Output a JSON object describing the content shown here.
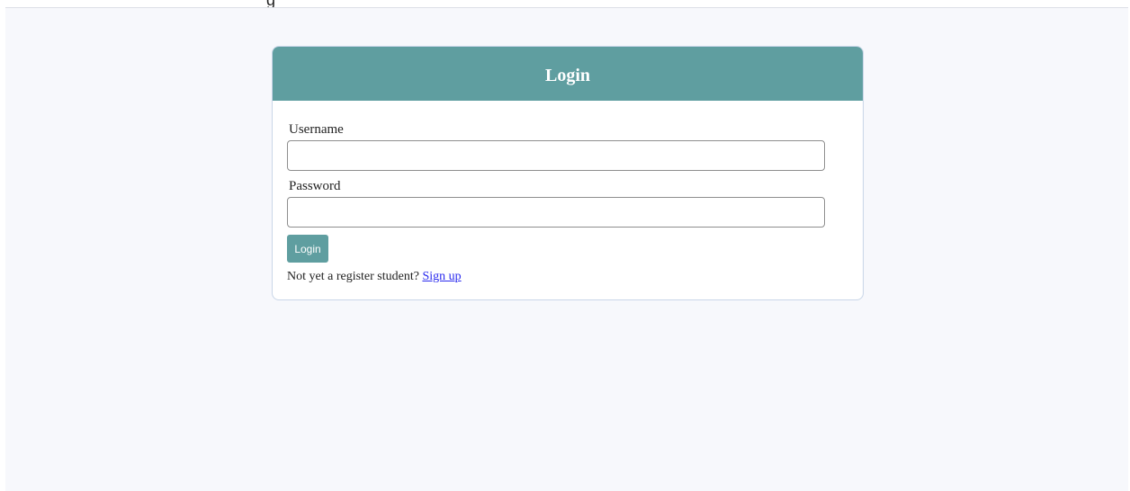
{
  "top_fragment": "g",
  "login_card": {
    "title": "Login",
    "username_label": "Username",
    "username_value": "",
    "password_label": "Password",
    "password_value": "",
    "login_button_label": "Login",
    "signup_prompt": "Not yet a register student?",
    "signup_link_label": "Sign up"
  },
  "colors": {
    "header_bg": "#5f9ea0",
    "button_bg": "#5f9ea0",
    "page_bg": "#f7f8fc",
    "link": "#2a2aee"
  }
}
